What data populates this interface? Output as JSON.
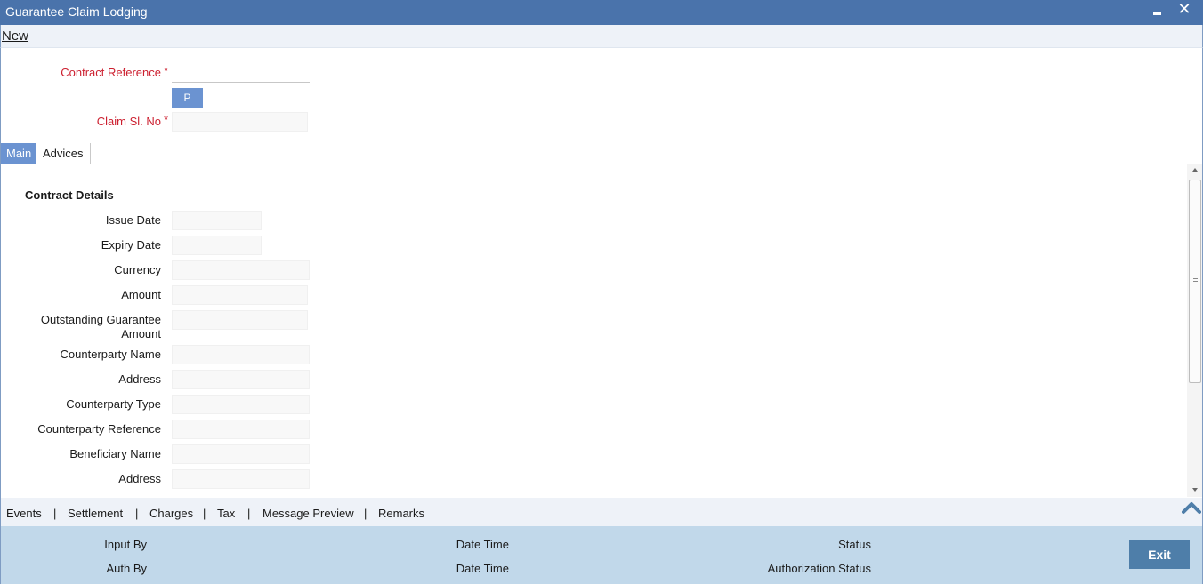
{
  "window": {
    "title": "Guarantee Claim Lodging"
  },
  "menu": {
    "new_label": "New"
  },
  "header_fields": {
    "contract_reference_label": "Contract Reference",
    "claim_sl_no_label": "Claim Sl. No",
    "required_mark": "*",
    "pickup_button_label": "P"
  },
  "tabs": [
    {
      "label": "Main",
      "active": true
    },
    {
      "label": "Advices",
      "active": false
    }
  ],
  "contract_details": {
    "section_title": "Contract Details",
    "fields": [
      {
        "label": "Issue Date",
        "value": ""
      },
      {
        "label": "Expiry Date",
        "value": ""
      },
      {
        "label": "Currency",
        "value": ""
      },
      {
        "label": "Amount",
        "value": ""
      },
      {
        "label_line1": "Outstanding Guarantee",
        "label_line2": "Amount",
        "value": ""
      },
      {
        "label": "Counterparty Name",
        "value": ""
      },
      {
        "label": "Address",
        "value": ""
      },
      {
        "label": "Counterparty Type",
        "value": ""
      },
      {
        "label": "Counterparty Reference",
        "value": ""
      },
      {
        "label": "Beneficiary Name",
        "value": ""
      },
      {
        "label": "Address",
        "value": ""
      }
    ]
  },
  "bottom_links": {
    "items": [
      "Events",
      "Settlement",
      "Charges",
      "Tax",
      "Message Preview",
      "Remarks"
    ],
    "separator": "|"
  },
  "footer": {
    "input_by": "Input By",
    "auth_by": "Auth By",
    "date_time_1": "Date Time",
    "date_time_2": "Date Time",
    "status": "Status",
    "authorization_status": "Authorization Status",
    "exit_label": "Exit"
  },
  "icons": {
    "minimize": "minimize-icon",
    "close": "close-icon",
    "collapse": "chevron-up-icon"
  },
  "colors": {
    "title_bar": "#4a73ab",
    "active_tab": "#6b93d1",
    "required_label": "#cc1f2f",
    "footer_bg": "#c1d8ea",
    "exit_button": "#4e7ea9"
  }
}
